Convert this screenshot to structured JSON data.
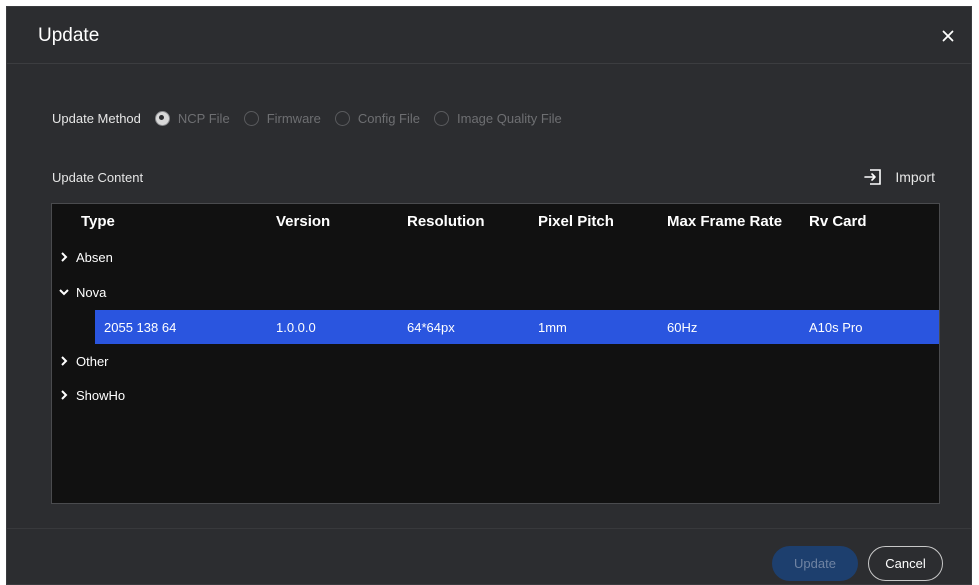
{
  "dialog": {
    "title": "Update",
    "close_icon": "close-icon"
  },
  "update_method": {
    "label": "Update Method",
    "options": [
      {
        "label": "NCP File",
        "checked": true
      },
      {
        "label": "Firmware",
        "checked": false
      },
      {
        "label": "Config File",
        "checked": false
      },
      {
        "label": "Image Quality File",
        "checked": false
      }
    ]
  },
  "update_content": {
    "label": "Update Content",
    "import_label": "Import",
    "import_icon": "import-icon"
  },
  "table": {
    "columns": [
      "Type",
      "Version",
      "Resolution",
      "Pixel Pitch",
      "Max Frame Rate",
      "Rv Card"
    ],
    "groups": [
      {
        "name": "Absen",
        "expanded": false
      },
      {
        "name": "Nova",
        "expanded": true
      },
      {
        "name": "Other",
        "expanded": false
      },
      {
        "name": "ShowHo",
        "expanded": false
      }
    ],
    "selected_row": {
      "type": "2055 138 64",
      "version": "1.0.0.0",
      "resolution": "64*64px",
      "pixel_pitch": "1mm",
      "max_frame_rate": "60Hz",
      "rv_card": "A10s Pro"
    },
    "selected_color": "#2a55df"
  },
  "footer": {
    "update_label": "Update",
    "cancel_label": "Cancel"
  }
}
